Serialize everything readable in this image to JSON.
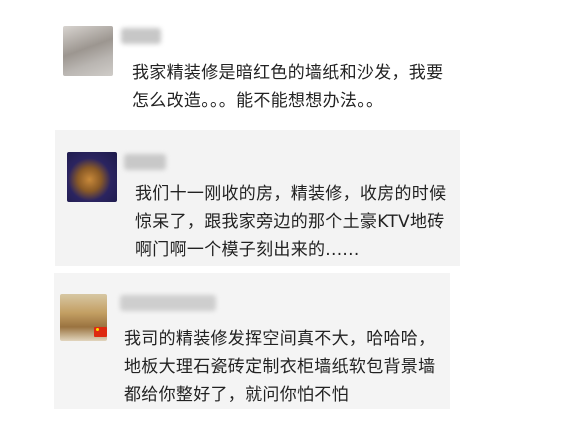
{
  "comments": [
    {
      "lines": [
        "我家精装修是暗红色的墙纸和沙发，我要",
        "怎么改造。。。能不能想想办法。。"
      ]
    },
    {
      "lines": [
        "我们十一刚收的房，精装修，收房的时候",
        "惊呆了，跟我家旁边的那个土豪KTV地砖",
        "啊门啊一个模子刻出来的......"
      ]
    },
    {
      "lines": [
        "我司的精装修发挥空间真不大，哈哈哈，",
        "地板大理石瓷砖定制衣柜墙纸软包背景墙",
        "都给你整好了，就问你怕不怕"
      ]
    }
  ]
}
